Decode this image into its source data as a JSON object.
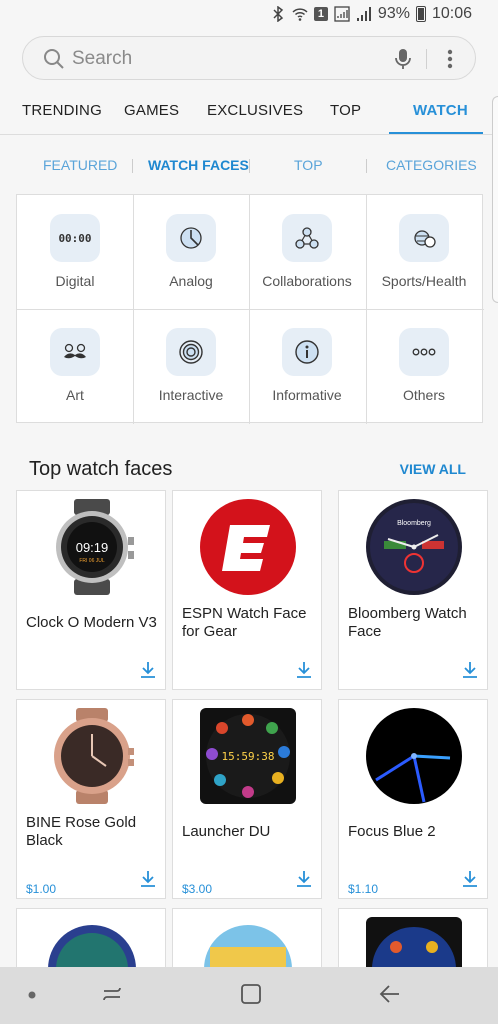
{
  "status": {
    "battery": "93%",
    "time": "10:06",
    "notification_badge": "1"
  },
  "search": {
    "placeholder": "Search"
  },
  "tabs": [
    {
      "label": "TRENDING"
    },
    {
      "label": "GAMES"
    },
    {
      "label": "EXCLUSIVES"
    },
    {
      "label": "TOP"
    },
    {
      "label": "WATCH"
    }
  ],
  "subtabs": [
    {
      "label": "FEATURED"
    },
    {
      "label": "WATCH FACES"
    },
    {
      "label": "TOP"
    },
    {
      "label": "CATEGORIES"
    }
  ],
  "categories": [
    {
      "label": "Digital",
      "icon": "digital-clock-icon",
      "icon_text": "00:00"
    },
    {
      "label": "Analog",
      "icon": "analog-clock-icon"
    },
    {
      "label": "Collaborations",
      "icon": "collaboration-icon"
    },
    {
      "label": "Sports/Health",
      "icon": "sports-icon"
    },
    {
      "label": "Art",
      "icon": "mustache-icon"
    },
    {
      "label": "Interactive",
      "icon": "target-icon"
    },
    {
      "label": "Informative",
      "icon": "info-icon"
    },
    {
      "label": "Others",
      "icon": "more-dots-icon"
    }
  ],
  "section": {
    "title": "Top watch faces",
    "view_all": "VIEW ALL"
  },
  "watchfaces": [
    {
      "name": "Clock O Modern V3",
      "price": "",
      "watch_time": "09:19",
      "watch_date": "FRI 06 JUL"
    },
    {
      "name": "ESPN Watch Face for Gear",
      "price": ""
    },
    {
      "name": "Bloomberg Watch Face",
      "price": "",
      "logo_text": "Bloomberg"
    },
    {
      "name": "BINE Rose Gold Black",
      "price": "$1.00"
    },
    {
      "name": "Launcher DU",
      "price": "$3.00",
      "watch_time": "15:59:38"
    },
    {
      "name": "Focus Blue 2",
      "price": "$1.10"
    }
  ],
  "colors": {
    "accent": "#2790d8",
    "espn_red": "#d3121b"
  }
}
